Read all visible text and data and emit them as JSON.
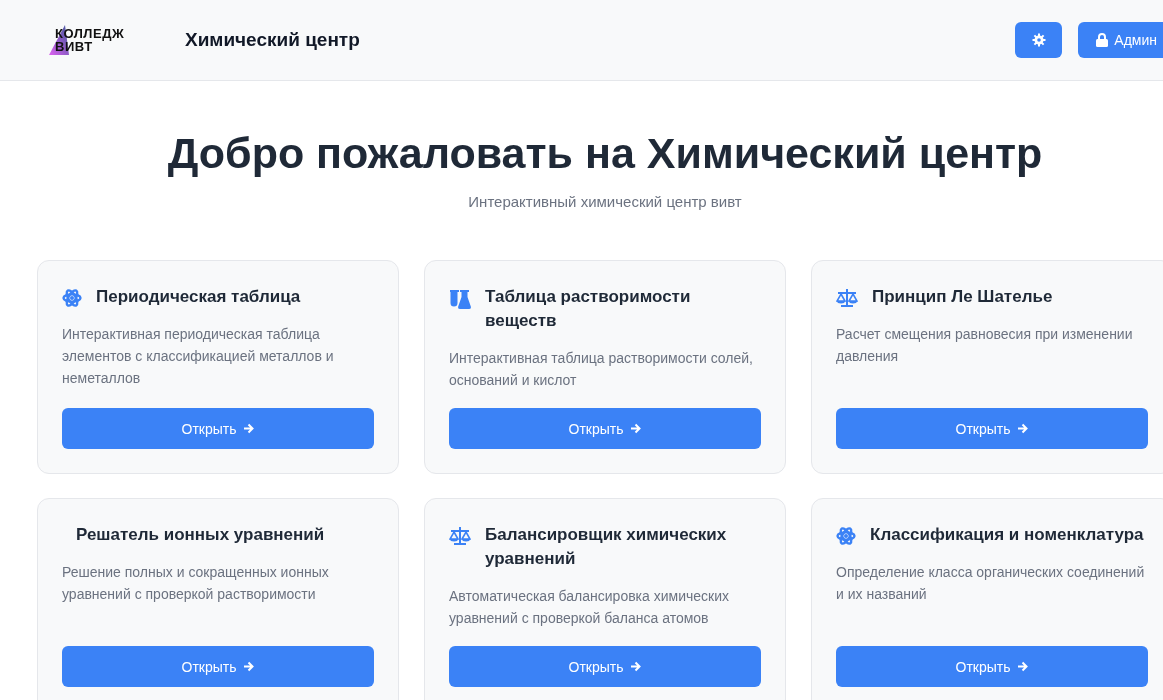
{
  "header": {
    "logo": {
      "line_1": "КОЛЛЕДЖ",
      "line_2": "ВИВТ"
    },
    "title": "Химический центр",
    "admin_button": "Админ"
  },
  "hero": {
    "title": "Добро пожаловать на Химический центр",
    "subtitle": "Интерактивный химический центр вивт"
  },
  "cards": [
    {
      "kind": "atom",
      "title": "Периодическая таблица",
      "description": "Интерактивная периодическая таблица элементов с классификацией металлов и неметаллов",
      "button": "Открыть"
    },
    {
      "kind": "flasks",
      "title": "Таблица растворимости веществ",
      "description": "Интерактивная таблица растворимости солей, оснований и кислот",
      "button": "Открыть"
    },
    {
      "kind": "scales",
      "title": "Принцип Ле Шателье",
      "description": "Расчет смещения равновесия при изменении давления",
      "button": "Открыть"
    },
    {
      "kind": "plain",
      "title": "Решатель ионных уравнений",
      "description": "Решение полных и сокращенных ионных уравнений с проверкой растворимости",
      "button": "Открыть"
    },
    {
      "kind": "scales",
      "title": "Балансировщик химических уравнений",
      "description": "Автоматическая балансировка химических уравнений с проверкой баланса атомов",
      "button": "Открыть"
    },
    {
      "kind": "atom",
      "title": "Классификация и номенклатура",
      "description": "Определение класса органических соединений и их названий",
      "button": "Открыть"
    }
  ]
}
